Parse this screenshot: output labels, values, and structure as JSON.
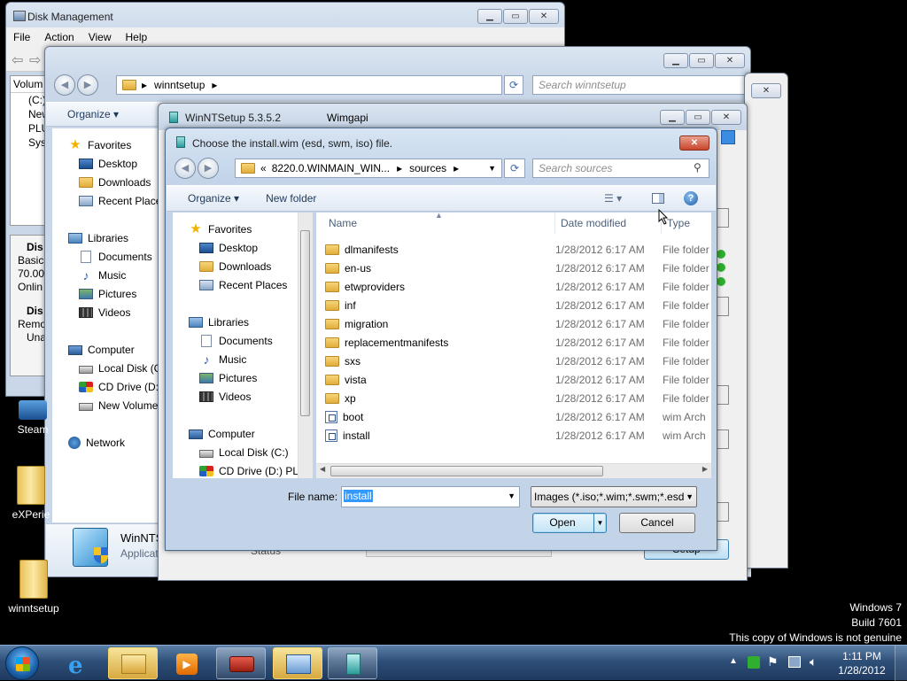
{
  "colors": {
    "desktop": "#000000",
    "accent": "#3399ff",
    "close_red": "#c8452b"
  },
  "disk_management": {
    "title": "Disk Management",
    "menu": [
      "File",
      "Action",
      "View",
      "Help"
    ],
    "col_header": "Volum",
    "volumes": [
      "(C:)",
      "New",
      "PLU",
      "Syst"
    ],
    "disk_info": [
      "Dis",
      "Basic",
      "70.00",
      "Onlin"
    ],
    "disk_info2": [
      "Dis",
      "Remo",
      "Una"
    ]
  },
  "explorer_back": {
    "address": "winntsetup",
    "search_placeholder": "Search winntsetup",
    "organize": "Organize",
    "nav": {
      "favorites": "Favorites",
      "desktop": "Desktop",
      "downloads": "Downloads",
      "recent": "Recent Places",
      "libraries": "Libraries",
      "documents": "Documents",
      "music": "Music",
      "pictures": "Pictures",
      "videos": "Videos",
      "computer": "Computer",
      "local_disk": "Local Disk (C",
      "cd_drive": "CD Drive (D:)",
      "new_volume": "New Volume",
      "network": "Network"
    },
    "details_name": "WinNTS",
    "details_sub": "Applicat"
  },
  "winntsetup": {
    "title": "WinNTSetup 5.3.5.2",
    "subtitle": "Wimgapi",
    "status": "Status",
    "setup": "Setup"
  },
  "dialog": {
    "title": "Choose the install.wim (esd, swm, iso) file.",
    "breadcrumb_prefix": "«",
    "breadcrumb": [
      "8220.0.WINMAIN_WIN...",
      "sources"
    ],
    "search_placeholder": "Search sources",
    "organize": "Organize",
    "new_folder": "New folder",
    "nav": {
      "favorites": "Favorites",
      "desktop": "Desktop",
      "downloads": "Downloads",
      "recent": "Recent Places",
      "libraries": "Libraries",
      "documents": "Documents",
      "music": "Music",
      "pictures": "Pictures",
      "videos": "Videos",
      "computer": "Computer",
      "local_disk": "Local Disk (C:)",
      "cd_drive": "CD Drive (D:) PLU"
    },
    "columns": {
      "name": "Name",
      "date": "Date modified",
      "type": "Type"
    },
    "files": [
      {
        "name": "dlmanifests",
        "date": "1/28/2012 6:17 AM",
        "type": "File folder",
        "kind": "folder"
      },
      {
        "name": "en-us",
        "date": "1/28/2012 6:17 AM",
        "type": "File folder",
        "kind": "folder"
      },
      {
        "name": "etwproviders",
        "date": "1/28/2012 6:17 AM",
        "type": "File folder",
        "kind": "folder"
      },
      {
        "name": "inf",
        "date": "1/28/2012 6:17 AM",
        "type": "File folder",
        "kind": "folder"
      },
      {
        "name": "migration",
        "date": "1/28/2012 6:17 AM",
        "type": "File folder",
        "kind": "folder"
      },
      {
        "name": "replacementmanifests",
        "date": "1/28/2012 6:17 AM",
        "type": "File folder",
        "kind": "folder"
      },
      {
        "name": "sxs",
        "date": "1/28/2012 6:17 AM",
        "type": "File folder",
        "kind": "folder"
      },
      {
        "name": "vista",
        "date": "1/28/2012 6:17 AM",
        "type": "File folder",
        "kind": "folder"
      },
      {
        "name": "xp",
        "date": "1/28/2012 6:17 AM",
        "type": "File folder",
        "kind": "folder"
      },
      {
        "name": "boot",
        "date": "1/28/2012 6:17 AM",
        "type": "wim Arch",
        "kind": "wim"
      },
      {
        "name": "install",
        "date": "1/28/2012 6:17 AM",
        "type": "wim Arch",
        "kind": "wim"
      }
    ],
    "file_name_label": "File name:",
    "file_name_value": "install",
    "filter": "Images (*.iso;*.wim;*.swm;*.esd",
    "open": "Open",
    "cancel": "Cancel"
  },
  "desktop_icons": {
    "steam": "Steam",
    "experience": "eXPerie",
    "winntsetup": "winntsetup"
  },
  "watermark": {
    "line1": "Windows 7",
    "line2": "Build 7601",
    "line3": "This copy of Windows is not genuine"
  },
  "clock": {
    "time": "1:11 PM",
    "date": "1/28/2012"
  }
}
